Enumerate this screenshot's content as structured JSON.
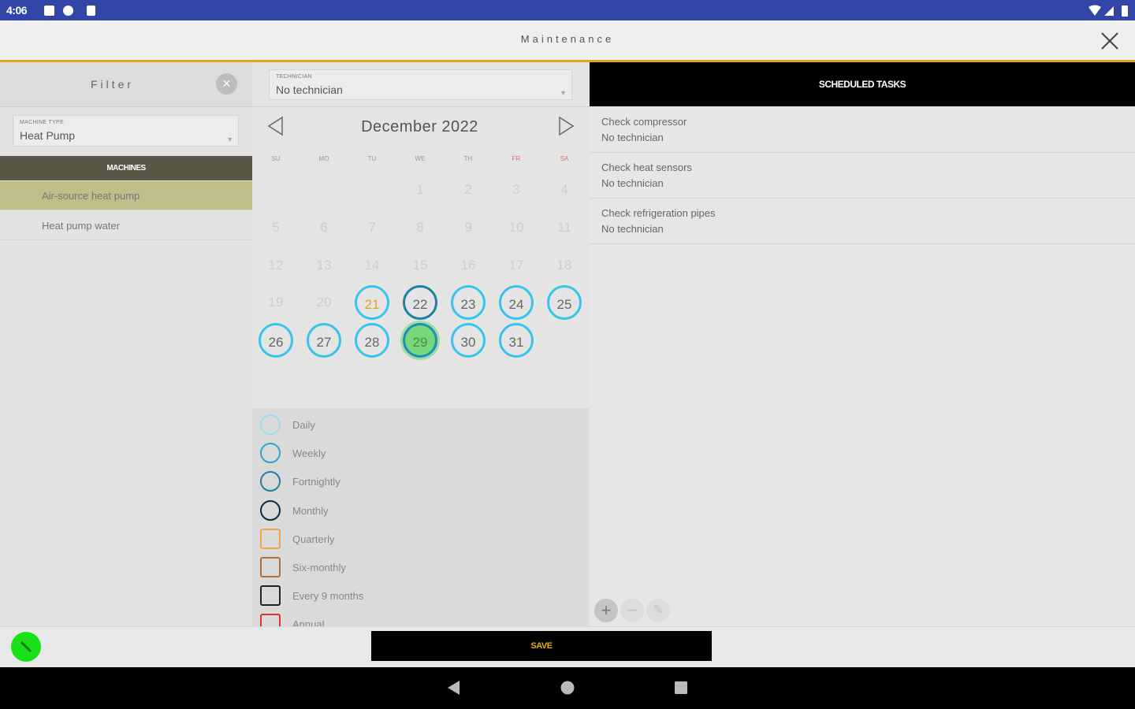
{
  "status_bar": {
    "time": "4:06"
  },
  "app_bar": {
    "title": "Maintenance"
  },
  "filter": {
    "title": "Filter",
    "clear_icon": "×",
    "machine_type": {
      "caption": "MACHINE TYPE",
      "value": "Heat Pump"
    },
    "machines_header": "MACHINES",
    "machines": [
      {
        "label": "Air-source heat pump",
        "selected": true
      },
      {
        "label": "Heat pump water",
        "selected": false
      }
    ]
  },
  "technician": {
    "caption": "TECHNICIAN",
    "value": "No technician"
  },
  "calendar": {
    "month": "December 2022",
    "weekdays": [
      "SU",
      "MO",
      "TU",
      "WE",
      "TH",
      "FR",
      "SA"
    ],
    "days": [
      "1",
      "2",
      "3",
      "4",
      "5",
      "6",
      "7",
      "8",
      "9",
      "10",
      "11",
      "12",
      "13",
      "14",
      "15",
      "16",
      "17",
      "18",
      "19",
      "20",
      "21",
      "22",
      "23",
      "24",
      "25",
      "26",
      "27",
      "28",
      "29",
      "30",
      "31"
    ],
    "scheduled_from": 21,
    "today": 22,
    "selected": 29
  },
  "legend": [
    {
      "label": "Daily",
      "color": "#9fdcf0",
      "shape": "circle"
    },
    {
      "label": "Weekly",
      "color": "#2aa6d0",
      "shape": "circle"
    },
    {
      "label": "Fortnightly",
      "color": "#1e7fa0",
      "shape": "circle"
    },
    {
      "label": "Monthly",
      "color": "#0d2b45",
      "shape": "circle"
    },
    {
      "label": "Quarterly",
      "color": "#f2a444",
      "shape": "square"
    },
    {
      "label": "Six-monthly",
      "color": "#b0703a",
      "shape": "square"
    },
    {
      "label": "Every 9 months",
      "color": "#222222",
      "shape": "square"
    },
    {
      "label": "Annual",
      "color": "#e03030",
      "shape": "square"
    }
  ],
  "tasks": {
    "header": "SCHEDULED TASKS",
    "items": [
      {
        "name": "Check compressor",
        "technician": "No technician"
      },
      {
        "name": "Check heat sensors",
        "technician": "No technician"
      },
      {
        "name": "Check refrigeration pipes",
        "technician": "No technician"
      }
    ],
    "add_icon": "+",
    "remove_icon": "−",
    "edit_icon": "✎"
  },
  "save_label": "SAVE",
  "colors": {
    "accent": "#e0a812",
    "machines_header": "#595746",
    "scheduled_ring": "#36c4ea",
    "selected_fill": "#77d77a",
    "fab": "#19e119",
    "save_text": "#e8b300"
  }
}
